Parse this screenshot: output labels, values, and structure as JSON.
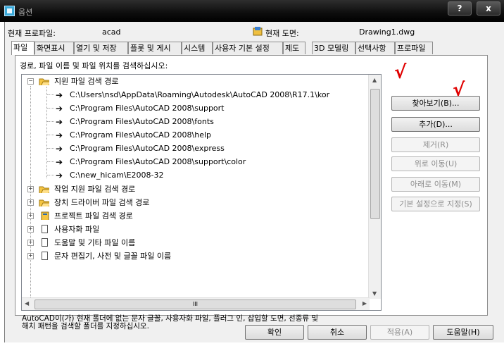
{
  "window": {
    "title": "옵션",
    "help_label": "?",
    "close_label": "x"
  },
  "header": {
    "profile_label": "현재 프로파일:",
    "profile_value": "acad",
    "drawing_label": "현재 도면:",
    "drawing_value": "Drawing1.dwg"
  },
  "tabs": [
    "파일",
    "화면표시",
    "열기 및 저장",
    "플롯 및 게시",
    "시스템",
    "사용자 기본 설정",
    "제도",
    "3D 모델링",
    "선택사항",
    "프로파일"
  ],
  "active_tab": "파일",
  "tree_caption": "경로, 파일 이름 및 파일 위치를 검색하십시오:",
  "tree": {
    "root_label": "지원 파일 검색 경로",
    "paths": [
      "C:\\Users\\nsd\\AppData\\Roaming\\Autodesk\\AutoCAD 2008\\R17.1\\kor",
      "C:\\Program Files\\AutoCAD 2008\\support",
      "C:\\Program Files\\AutoCAD 2008\\fonts",
      "C:\\Program Files\\AutoCAD 2008\\help",
      "C:\\Program Files\\AutoCAD 2008\\express",
      "C:\\Program Files\\AutoCAD 2008\\support\\color",
      "C:\\new_hicam\\E2008-32"
    ],
    "nodes": [
      {
        "label": "작업 지원 파일 검색 경로",
        "icon": "folder-icon"
      },
      {
        "label": "장치 드라이버 파일 검색 경로",
        "icon": "folder-icon"
      },
      {
        "label": "프로젝트 파일 검색 경로",
        "icon": "project-icon"
      },
      {
        "label": "사용자화 파일",
        "icon": "document-icon"
      },
      {
        "label": "도움말 및 기타 파일 이름",
        "icon": "document-icon"
      },
      {
        "label": "문자 편집기, 사전 및 글꼴 파일 이름",
        "icon": "document-icon"
      }
    ],
    "hscroll_grip": "III"
  },
  "side_buttons": {
    "browse": "찾아보기(B)...",
    "add": "추가(D)...",
    "remove": "제거(R)",
    "move_up": "위로 이동(U)",
    "move_down": "아래로 이동(M)",
    "set_current": "기본 설정으로 지정(S)"
  },
  "description": [
    "AutoCAD이(가) 현재 폴더에 없는 문자 글꼴, 사용자화 파일, 플러그 인, 삽입할 도면, 선종류 및",
    "해치 패턴을 검색할 폴더를 지정하십시오."
  ],
  "bottom_buttons": {
    "ok": "확인",
    "cancel": "취소",
    "apply": "적용(A)",
    "help": "도움말(H)"
  },
  "annotations": {
    "checkmark": "√"
  },
  "colors": {
    "titlebar": "#000000",
    "annotation": "#e00000",
    "folder": "#f5c542"
  }
}
